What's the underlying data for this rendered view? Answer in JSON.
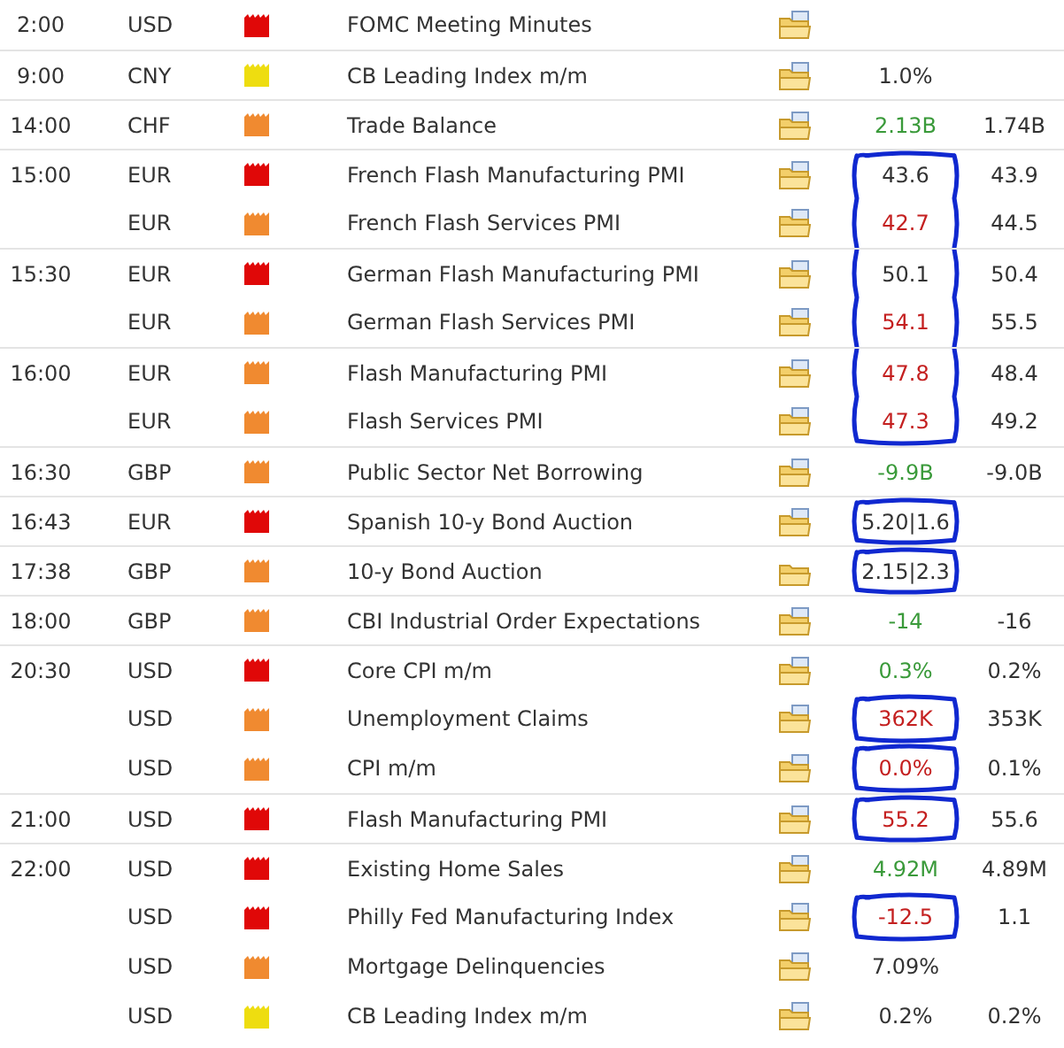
{
  "events": [
    {
      "time": "2:00",
      "currency": "USD",
      "color": "#e00808",
      "event": "FOMC Meeting Minutes",
      "report": true
    },
    {
      "time": "9:00",
      "currency": "CNY",
      "color": "#eedd10",
      "event": "CB Leading Index m/m",
      "report": true,
      "actual": {
        "text": "1.0%",
        "color": "#333333"
      }
    },
    {
      "time": "14:00",
      "currency": "CHF",
      "color": "#f08a30",
      "event": "Trade Balance",
      "report": true,
      "actual": {
        "text": "2.13B",
        "color": "#3a9a3a"
      },
      "forecast": "1.74B"
    },
    {
      "time": "15:00",
      "currency": "EUR",
      "color": "#e00808",
      "event": "French Flash Manufacturing PMI",
      "report": true,
      "actual": {
        "text": "43.6",
        "color": "#333333"
      },
      "forecast": "43.9",
      "circled": true,
      "circle_continues": true
    },
    {
      "currency": "EUR",
      "color": "#f08a30",
      "event": "French Flash Services PMI",
      "report": true,
      "actual": {
        "text": "42.7",
        "color": "#c42020"
      },
      "forecast": "44.5",
      "circled": true,
      "circle_continues": true
    },
    {
      "time": "15:30",
      "currency": "EUR",
      "color": "#e00808",
      "event": "German Flash Manufacturing PMI",
      "report": true,
      "actual": {
        "text": "50.1",
        "color": "#333333"
      },
      "forecast": "50.4",
      "circled": true,
      "circle_continues": true
    },
    {
      "currency": "EUR",
      "color": "#f08a30",
      "event": "German Flash Services PMI",
      "report": true,
      "actual": {
        "text": "54.1",
        "color": "#c42020"
      },
      "forecast": "55.5",
      "circled": true,
      "circle_continues": true
    },
    {
      "time": "16:00",
      "currency": "EUR",
      "color": "#f08a30",
      "event": "Flash Manufacturing PMI",
      "report": true,
      "actual": {
        "text": "47.8",
        "color": "#c42020"
      },
      "forecast": "48.4",
      "circled": true,
      "circle_continues": true
    },
    {
      "currency": "EUR",
      "color": "#f08a30",
      "event": "Flash Services PMI",
      "report": true,
      "actual": {
        "text": "47.3",
        "color": "#c42020"
      },
      "forecast": "49.2",
      "circled": true
    },
    {
      "time": "16:30",
      "currency": "GBP",
      "color": "#f08a30",
      "event": "Public Sector Net Borrowing",
      "report": true,
      "actual": {
        "text": "-9.9B",
        "color": "#3a9a3a"
      },
      "forecast": "-9.0B"
    },
    {
      "time": "16:43",
      "currency": "EUR",
      "color": "#e00808",
      "event": "Spanish 10-y Bond Auction",
      "report": true,
      "actual": {
        "text": "5.20|1.6",
        "color": "#333333"
      },
      "circled": true
    },
    {
      "time": "17:38",
      "currency": "GBP",
      "color": "#f08a30",
      "event": "10-y Bond Auction",
      "report": false,
      "actual": {
        "text": "2.15|2.3",
        "color": "#333333"
      },
      "circled": true
    },
    {
      "time": "18:00",
      "currency": "GBP",
      "color": "#f08a30",
      "event": "CBI Industrial Order Expectations",
      "report": true,
      "actual": {
        "text": "-14",
        "color": "#3a9a3a"
      },
      "forecast": "-16"
    },
    {
      "time": "20:30",
      "currency": "USD",
      "color": "#e00808",
      "event": "Core CPI m/m",
      "report": true,
      "actual": {
        "text": "0.3%",
        "color": "#3a9a3a"
      },
      "forecast": "0.2%"
    },
    {
      "currency": "USD",
      "color": "#f08a30",
      "event": "Unemployment Claims",
      "report": true,
      "actual": {
        "text": "362K",
        "color": "#c42020"
      },
      "forecast": "353K",
      "circled": true
    },
    {
      "currency": "USD",
      "color": "#f08a30",
      "event": "CPI m/m",
      "report": true,
      "actual": {
        "text": "0.0%",
        "color": "#c42020"
      },
      "forecast": "0.1%",
      "circled": true
    },
    {
      "time": "21:00",
      "currency": "USD",
      "color": "#e00808",
      "event": "Flash Manufacturing PMI",
      "report": true,
      "actual": {
        "text": "55.2",
        "color": "#c42020"
      },
      "forecast": "55.6",
      "circled": true
    },
    {
      "time": "22:00",
      "currency": "USD",
      "color": "#e00808",
      "event": "Existing Home Sales",
      "report": true,
      "actual": {
        "text": "4.92M",
        "color": "#3a9a3a"
      },
      "forecast": "4.89M"
    },
    {
      "currency": "USD",
      "color": "#e00808",
      "event": "Philly Fed Manufacturing Index",
      "report": true,
      "actual": {
        "text": "-12.5",
        "color": "#c42020"
      },
      "forecast": "1.1",
      "circled": true
    },
    {
      "currency": "USD",
      "color": "#f08a30",
      "event": "Mortgage Delinquencies",
      "report": true,
      "actual": {
        "text": "7.09%",
        "color": "#333333"
      }
    },
    {
      "currency": "USD",
      "color": "#eedd10",
      "event": "CB Leading Index m/m",
      "report": true,
      "actual": {
        "text": "0.2%",
        "color": "#333333"
      },
      "forecast": "0.2%"
    }
  ]
}
